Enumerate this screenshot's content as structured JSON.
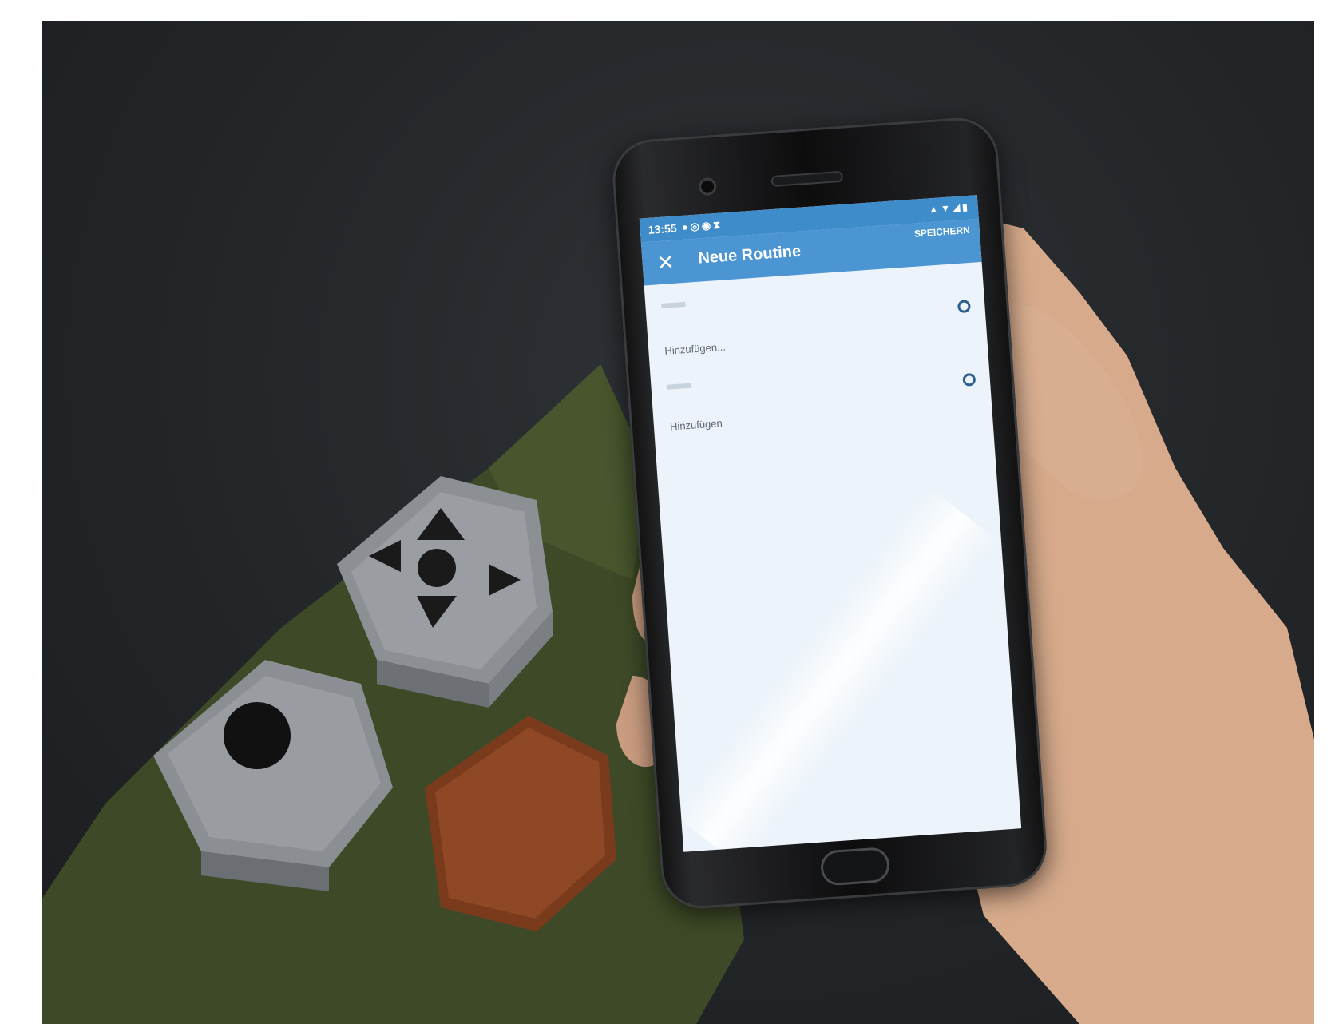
{
  "phone_ui": {
    "status_bar": {
      "time": "13:55",
      "left_icons": [
        "notification-icon",
        "whatsapp-icon",
        "app-icon",
        "hourglass-icon"
      ],
      "right_icons": [
        "bell-icon",
        "wifi-icon",
        "signal-icon",
        "battery-icon"
      ]
    },
    "app_bar": {
      "close_icon": "close-icon",
      "title": "Neue Routine",
      "save_label": "SPEICHERN"
    },
    "sections": [
      {
        "add_label": "Hinzufügen..."
      },
      {
        "add_label": "Hinzufügen"
      }
    ]
  },
  "colors": {
    "app_bar": "#4a95d2",
    "status_bar": "#3f8ccb",
    "screen_background": "#ecf3fa",
    "photo_background": "#25282b",
    "sleeve": "#3f4a26",
    "wood_button": "#7a3a1c"
  }
}
